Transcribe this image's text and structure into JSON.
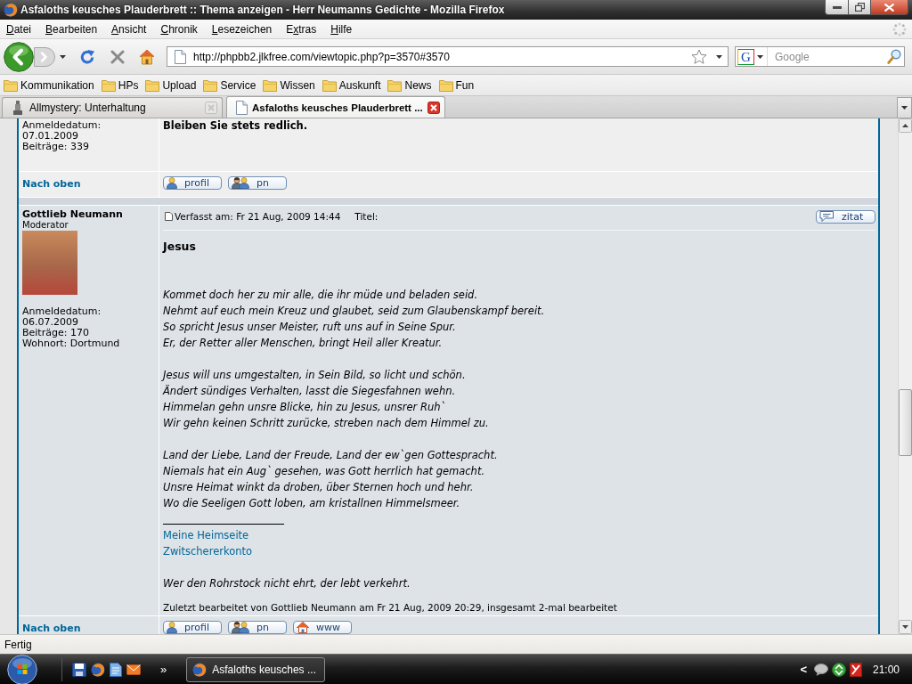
{
  "window": {
    "title": "Asfaloths keusches Plauderbrett :: Thema anzeigen - Herr Neumanns Gedichte - Mozilla Firefox"
  },
  "menu": [
    {
      "access_key": "D",
      "after": "atei"
    },
    {
      "access_key": "B",
      "after": "earbeiten"
    },
    {
      "access_key": "A",
      "after": "nsicht"
    },
    {
      "access_key": "C",
      "after": "hronik"
    },
    {
      "access_key": "L",
      "after": "esezeichen"
    },
    {
      "before": "E",
      "access_key": "x",
      "after": "tras"
    },
    {
      "access_key": "H",
      "after": "ilfe"
    }
  ],
  "toolbar": {
    "url": "http://phpbb2.jlkfree.com/viewtopic.php?p=3570#3570",
    "search": {
      "engine": "G",
      "placeholder": "Google"
    }
  },
  "bookmarks": [
    "Kommunikation",
    "HPs",
    "Upload",
    "Service",
    "Wissen",
    "Auskunft",
    "News",
    "Fun"
  ],
  "tabs": [
    {
      "label": "Allmystery: Unterhaltung",
      "kind": "site",
      "selected": false
    },
    {
      "label": "Asfaloths keusches Plauderbrett ...",
      "kind": "page",
      "selected": true
    }
  ],
  "posts": [
    {
      "author_details": [
        "Anmeldedatum: 07.01.2009",
        "Beiträge: 339"
      ],
      "body": [
        {
          "kind": "bold",
          "text": "Bleiben Sie stets redlich."
        }
      ],
      "back_to_top": "Nach oben",
      "buttons": [
        {
          "kind": "profile",
          "label": "profil"
        },
        {
          "kind": "message",
          "label": "pn"
        }
      ]
    },
    {
      "author": "Gottlieb Neumann",
      "rank": "Moderator",
      "avatar": true,
      "author_details": [
        "Anmeldedatum: 06.07.2009",
        "Beiträge: 170",
        "Wohnort: Dortmund"
      ],
      "posted": "Verfasst am: Fr 21 Aug, 2009 14:44",
      "subject_label": "Titel:",
      "quote_button": "zitat",
      "body": [
        {
          "kind": "title",
          "text": "Jesus"
        },
        {
          "kind": "stanza",
          "lines": [
            "Kommet doch her zu mir alle, die ihr müde und beladen seid.",
            "Nehmt auf euch mein Kreuz und glaubet, seid zum Glaubenskampf bereit.",
            "So spricht Jesus unser Meister, ruft uns auf in Seine Spur.",
            "Er, der Retter aller Menschen, bringt Heil aller Kreatur."
          ]
        },
        {
          "kind": "stanza",
          "lines": [
            "Jesus will uns umgestalten, in Sein Bild, so licht und schön.",
            "Ändert sündiges Verhalten, lasst die Siegesfahnen wehn.",
            "Himmelan gehn unsre Blicke, hin zu Jesus, unsrer Ruh`",
            "Wir gehn keinen Schritt zurücke, streben nach dem Himmel zu."
          ]
        },
        {
          "kind": "stanza",
          "lines": [
            "Land der Liebe, Land der Freude, Land der ew`gen Gottespracht.",
            "Niemals hat ein Aug` gesehen, was Gott herrlich hat gemacht.",
            "Unsre Heimat winkt da droben, über Sternen hoch und hehr.",
            "Wo die Seeligen Gott loben, am kristallnen Himmelsmeer."
          ]
        }
      ],
      "signature": {
        "links": [
          "Meine Heimseite",
          "Zwitschererkonto"
        ],
        "motto": "Wer den Rohrstock nicht ehrt, der lebt verkehrt."
      },
      "edit_note": "Zuletzt bearbeitet von Gottlieb Neumann am Fr 21 Aug, 2009 20:29, insgesamt 2-mal bearbeitet",
      "back_to_top": "Nach oben",
      "buttons": [
        {
          "kind": "profile",
          "label": "profil"
        },
        {
          "kind": "message",
          "label": "pn"
        },
        {
          "kind": "website",
          "label": "www"
        }
      ]
    }
  ],
  "status_bar": {
    "text": "Fertig"
  },
  "taskbar": {
    "overflow": "»",
    "tasks": [
      {
        "label": "Asfaloths keusches ..."
      }
    ],
    "tray_expand": "<",
    "clock": "21:00"
  }
}
